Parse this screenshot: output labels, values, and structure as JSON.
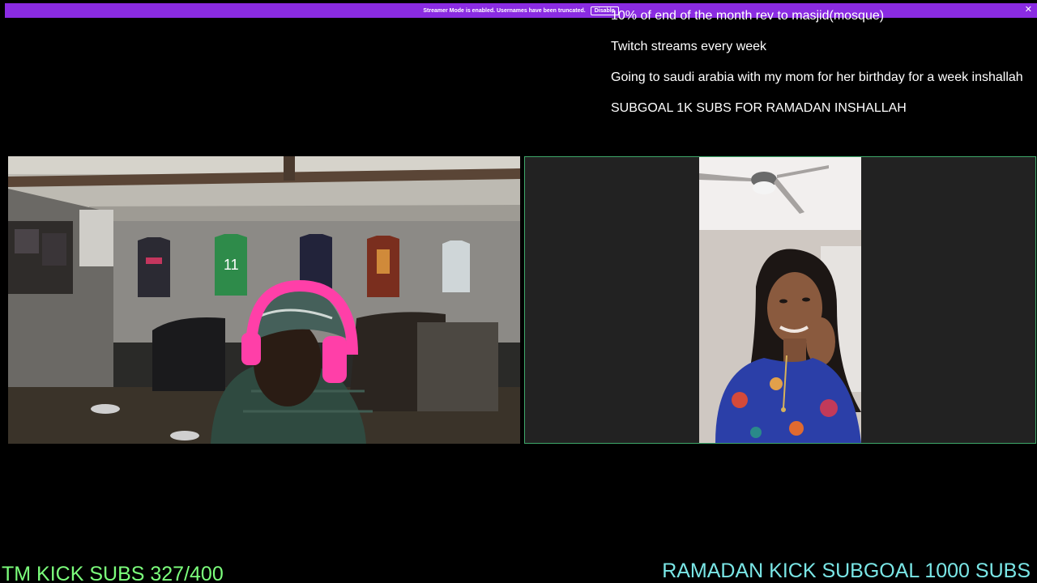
{
  "streamer_banner": {
    "message": "Streamer Mode is enabled. Usernames have been truncated.",
    "disable_label": "Disable",
    "close_glyph": "✕",
    "color": "#8a2be2"
  },
  "ticker_lines": [
    "10% of end of the month rev to masjid(mosque)",
    "Twitch streams every week",
    "Going to saudi arabia with my mom for her birthday for a week inshallah",
    "SUBGOAL 1K SUBS FOR RAMADAN INSHALLAH"
  ],
  "webcam_left": {
    "scene": "streamer-room-with-jerseys"
  },
  "webcam_right": {
    "scene": "video-call-portrait",
    "border_color": "#3fa86a"
  },
  "footer": {
    "left_label": "TM KICK SUBS 327/400",
    "left_color": "#7cff7c",
    "right_label": "RAMADAN KICK SUBGOAL 1000 SUBS",
    "right_color": "#7ae6e6"
  }
}
